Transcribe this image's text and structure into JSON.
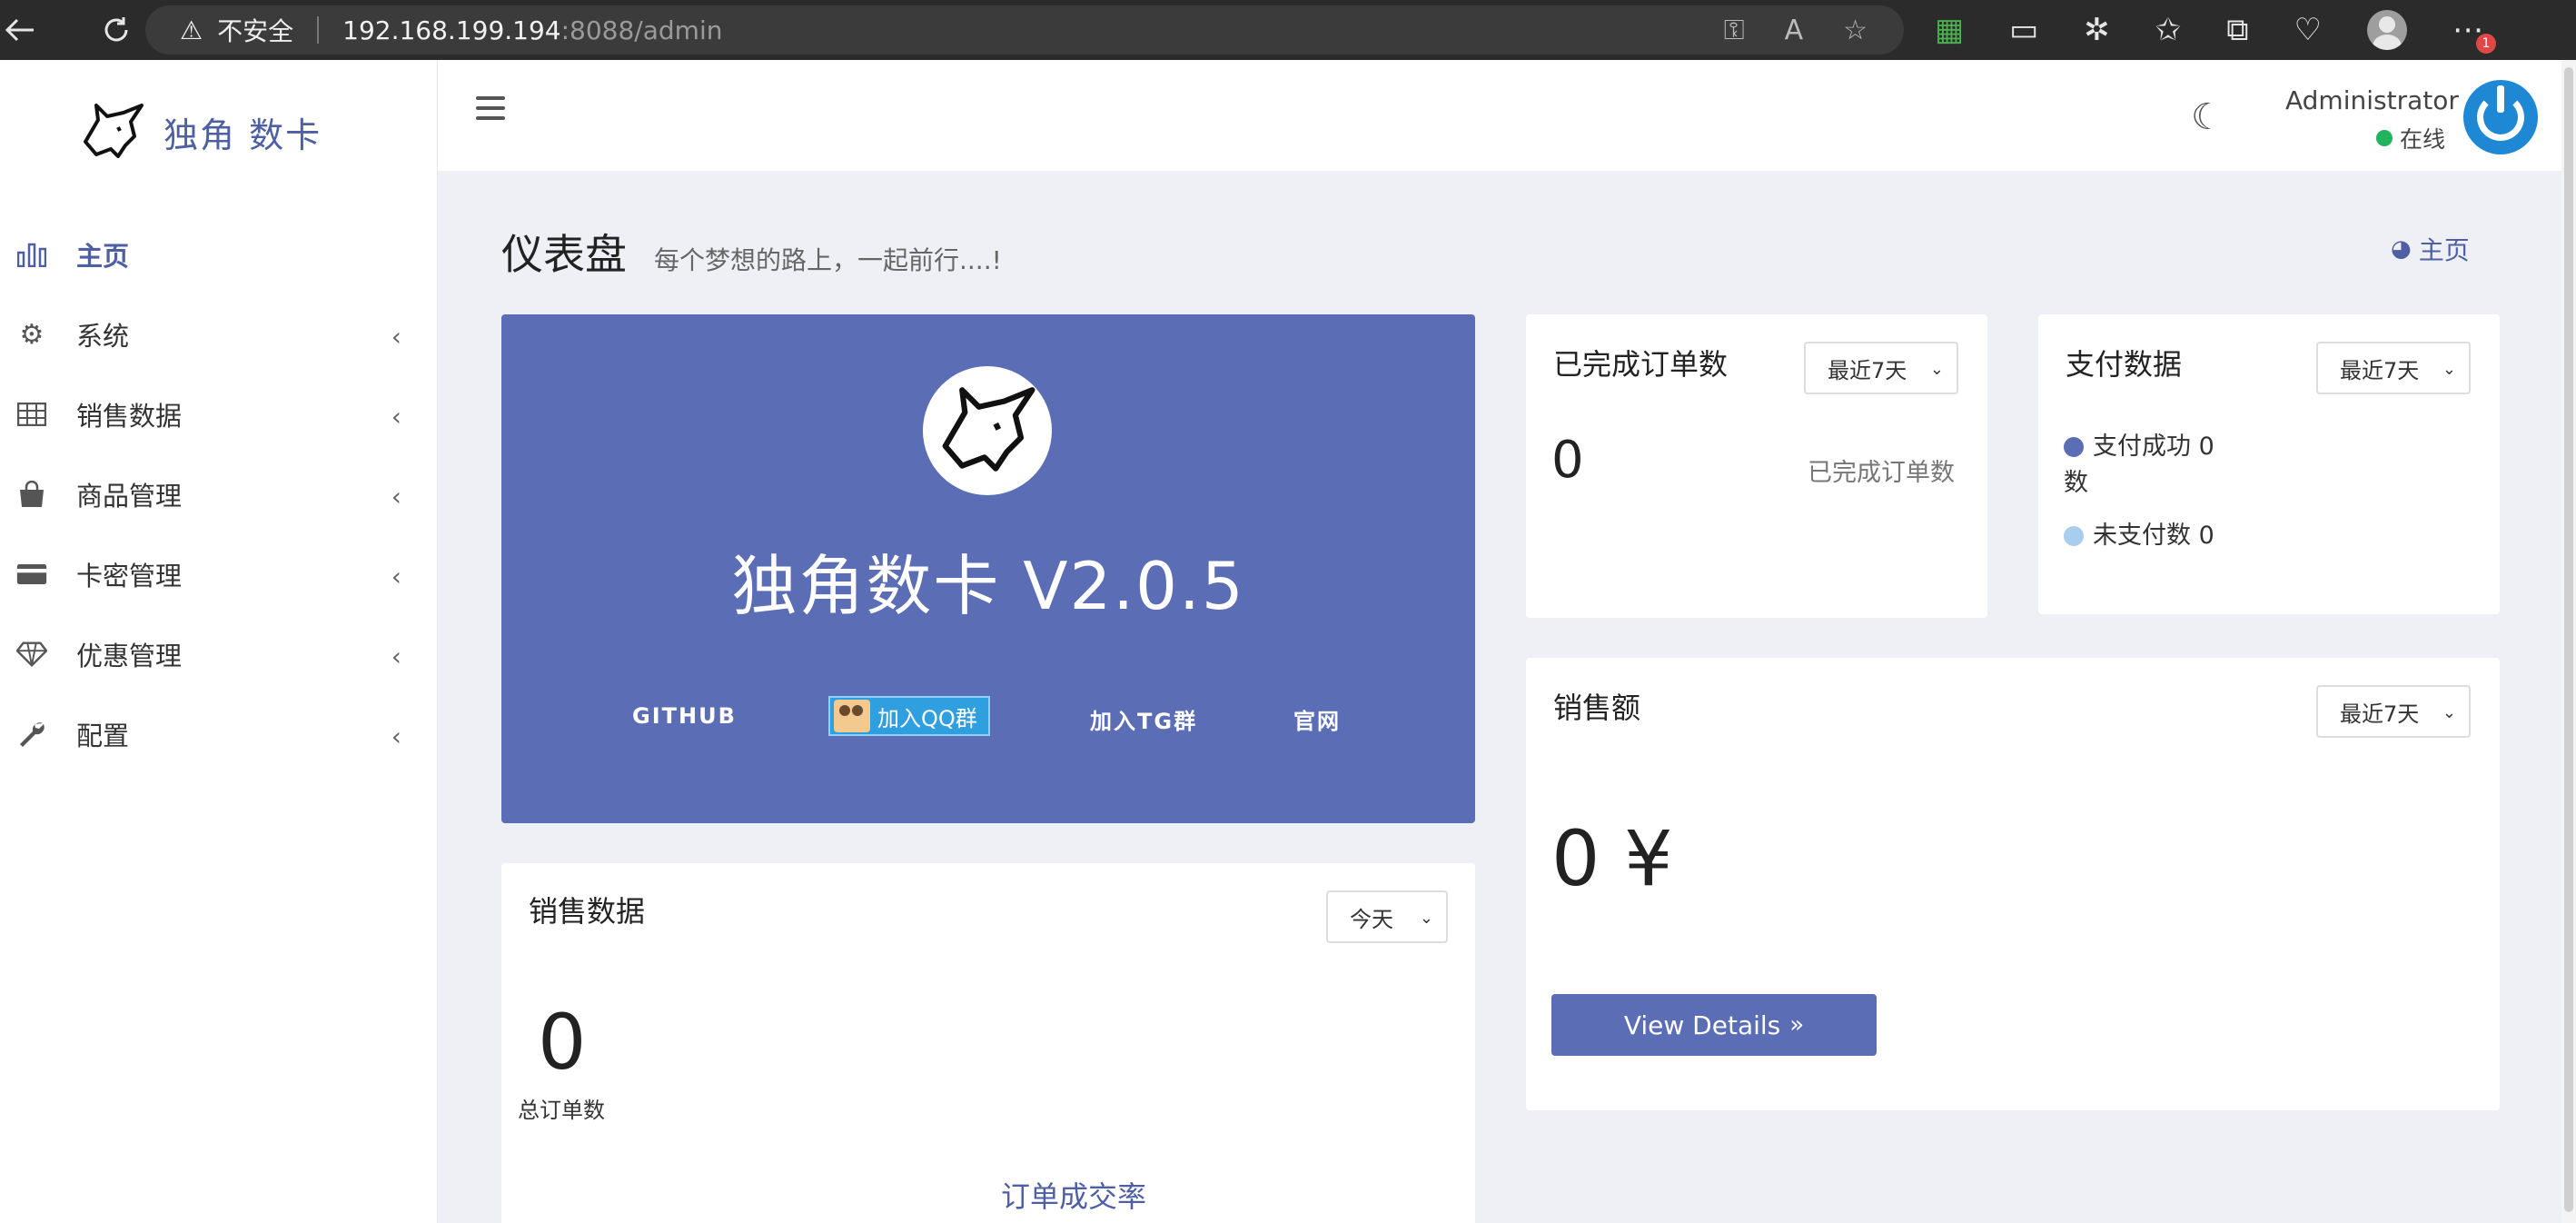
{
  "browser": {
    "insecure_label": "不安全",
    "url_host": "192.168.199.194",
    "url_rest": ":8088/admin",
    "more_badge": "1"
  },
  "brand": {
    "name": "独角 数卡"
  },
  "sidebar": {
    "items": [
      {
        "label": "主页",
        "icon": "bar-chart-icon",
        "active": true
      },
      {
        "label": "系统",
        "icon": "gear-icon"
      },
      {
        "label": "销售数据",
        "icon": "table-icon"
      },
      {
        "label": "商品管理",
        "icon": "shopping-bag-icon"
      },
      {
        "label": "卡密管理",
        "icon": "credit-card-icon"
      },
      {
        "label": "优惠管理",
        "icon": "diamond-icon"
      },
      {
        "label": "配置",
        "icon": "wrench-icon"
      }
    ]
  },
  "header": {
    "user_name": "Administrator",
    "user_status": "在线",
    "status_color": "#22b35e"
  },
  "page": {
    "title": "仪表盘",
    "subtitle": "每个梦想的路上，一起前行....!",
    "breadcrumb": "主页"
  },
  "hero": {
    "version_title": "独角数卡 V2.0.5",
    "links": {
      "github": "GITHUB",
      "qq": "加入QQ群",
      "tg": "加入TG群",
      "site": "官网"
    },
    "bg_color": "#5a6db5"
  },
  "completed_orders": {
    "title": "已完成订单数",
    "filter": "最近7天",
    "value": "0",
    "label": "已完成订单数"
  },
  "payment": {
    "title": "支付数据",
    "filter": "最近7天",
    "success_label": "支付成功 0",
    "success_label_wrap": "数",
    "unpaid_label": "未支付数 0",
    "success_color": "#5a6db5",
    "unpaid_color": "#a9cdee"
  },
  "sales_amount": {
    "title": "销售额",
    "filter": "最近7天",
    "value": "0 ¥",
    "button": "View Details",
    "button_icon": "»"
  },
  "sales_data": {
    "title": "销售数据",
    "filter": "今天",
    "value": "0",
    "label": "总订单数",
    "footer_link": "订单成交率"
  }
}
